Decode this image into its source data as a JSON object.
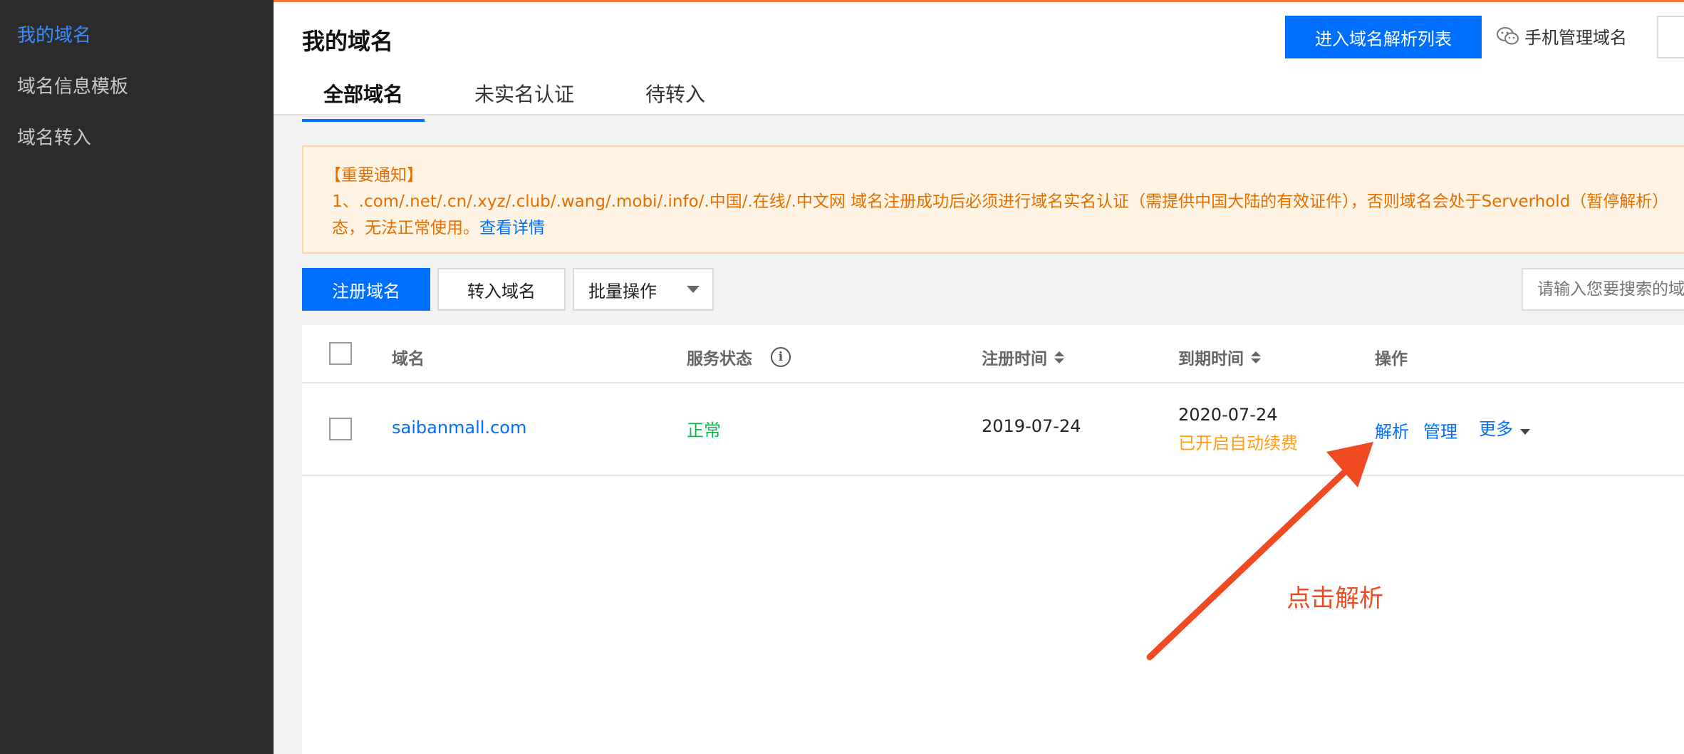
{
  "sidebar": {
    "items": [
      {
        "label": "我的域名",
        "active": true
      },
      {
        "label": "域名信息模板",
        "active": false
      },
      {
        "label": "域名转入",
        "active": false
      }
    ]
  },
  "header": {
    "title": "我的域名",
    "dns_list_button": "进入域名解析列表",
    "mobile_manage": "手机管理域名",
    "tabs": [
      {
        "label": "全部域名",
        "active": true
      },
      {
        "label": "未实名认证",
        "active": false
      },
      {
        "label": "待转入",
        "active": false
      }
    ]
  },
  "notice": {
    "title": "【重要通知】",
    "line1": "1、.com/.net/.cn/.xyz/.club/.wang/.mobi/.info/.中国/.在线/.中文网 域名注册成功后必须进行域名实名认证（需提供中国大陆的有效证件），否则域名会处于Serverhold（暂停解析）",
    "line2": "态，无法正常使用。",
    "link": "查看详情"
  },
  "toolbar": {
    "register": "注册域名",
    "transfer": "转入域名",
    "batch": "批量操作",
    "search_placeholder": "请输入您要搜索的域"
  },
  "table": {
    "columns": [
      "域名",
      "服务状态",
      "注册时间",
      "到期时间",
      "操作"
    ],
    "rows": [
      {
        "domain": "saibanmall.com",
        "status": "正常",
        "registered": "2019-07-24",
        "expires": "2020-07-24",
        "renew_note": "已开启自动续费",
        "actions": {
          "resolve": "解析",
          "manage": "管理",
          "more": "更多"
        }
      }
    ]
  },
  "annotation": {
    "text": "点击解析",
    "color": "#f04a23"
  },
  "colors": {
    "primary": "#006eff",
    "sidebar_bg": "#2c2c2c",
    "notice_text": "#e46f00",
    "status_ok": "#12b34a",
    "renew": "#ff9c19"
  }
}
